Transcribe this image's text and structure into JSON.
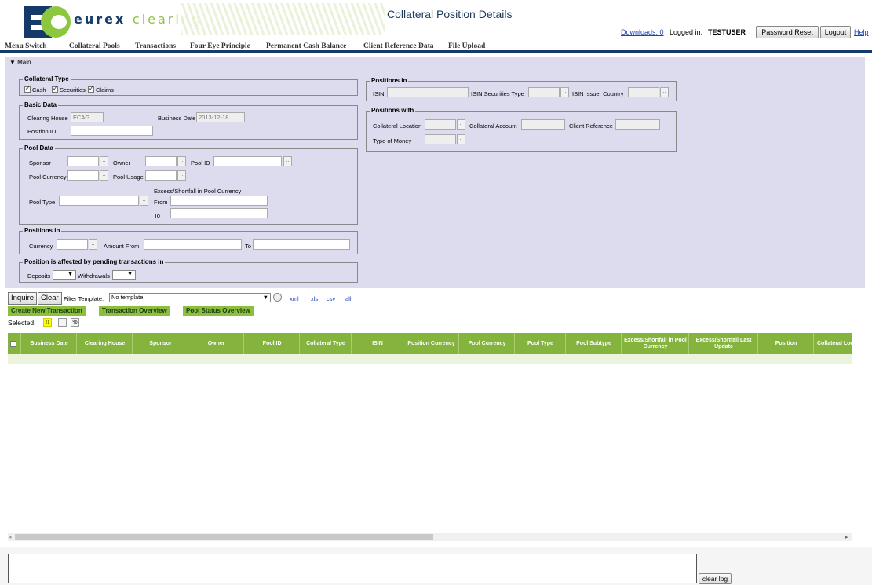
{
  "header": {
    "logo_text_1": "eurex",
    "logo_text_2": "clearing",
    "page_title": "Collateral Position Details",
    "downloads": "Downloads: 0",
    "logged_in_label": "Logged in:",
    "user": "TESTUSER",
    "password_reset": "Password Reset",
    "logout": "Logout",
    "help": "Help"
  },
  "menu": [
    "Menu Switch",
    "Collateral Pools",
    "Transactions",
    "Four Eye Principle",
    "Permanent Cash Balance",
    "Client Reference Data",
    "File Upload"
  ],
  "main": {
    "toggle": "▼ Main",
    "collateral_type": {
      "legend": "Collateral Type",
      "cash": "Cash",
      "securities": "Securities",
      "claims": "Claims"
    },
    "basic_data": {
      "legend": "Basic Data",
      "clearing_house_label": "Clearing House",
      "clearing_house_value": "ECAG",
      "business_date_label": "Business Date",
      "business_date_value": "2013-12-18",
      "position_id_label": "Position ID"
    },
    "pool_data": {
      "legend": "Pool Data",
      "sponsor": "Sponsor",
      "owner": "Owner",
      "pool_id": "Pool ID",
      "pool_currency": "Pool Currency",
      "pool_usage": "Pool Usage",
      "excess_label": "Excess/Shortfall in Pool Currency",
      "pool_type": "Pool Type",
      "from": "From",
      "to": "To"
    },
    "positions_in_1": {
      "legend": "Positions in",
      "currency": "Currency",
      "amount_from": "Amount  From",
      "to": "To"
    },
    "pending": {
      "legend": "Position is affected by pending transactions in",
      "deposits": "Deposits",
      "withdrawals": "Withdrawals"
    },
    "positions_in_2": {
      "legend": "Positions in",
      "isin": "ISIN",
      "isin_type": "ISIN Securities Type",
      "isin_country": "ISIN Issuer Country"
    },
    "positions_with": {
      "legend": "Positions with",
      "location": "Collateral Location",
      "account": "Collateral Account",
      "client_ref": "Client Reference",
      "type_of_money": "Type of Money"
    }
  },
  "toolbar": {
    "inquire": "Inquire",
    "clear": "Clear",
    "filter_label": "Filter Template:",
    "filter_value": "No template",
    "exports": [
      "xml",
      "xls",
      "csv",
      "all"
    ]
  },
  "actions": [
    "Create New Transaction",
    "Transaction Overview",
    "Pool Status Overview"
  ],
  "selected": {
    "label": "Selected:",
    "count": "0"
  },
  "columns": [
    "Business Date",
    "Clearing House",
    "Sponsor",
    "Owner",
    "Pool ID",
    "Collateral Type",
    "ISIN",
    "Position Currency",
    "Pool Currency",
    "Pool Type",
    "Pool Subtype",
    "Excess/Shortfall in Pool Currency",
    "Excess/Shortfall Last Update",
    "Position",
    "Collateral Location"
  ],
  "log": {
    "clear": "clear log"
  }
}
